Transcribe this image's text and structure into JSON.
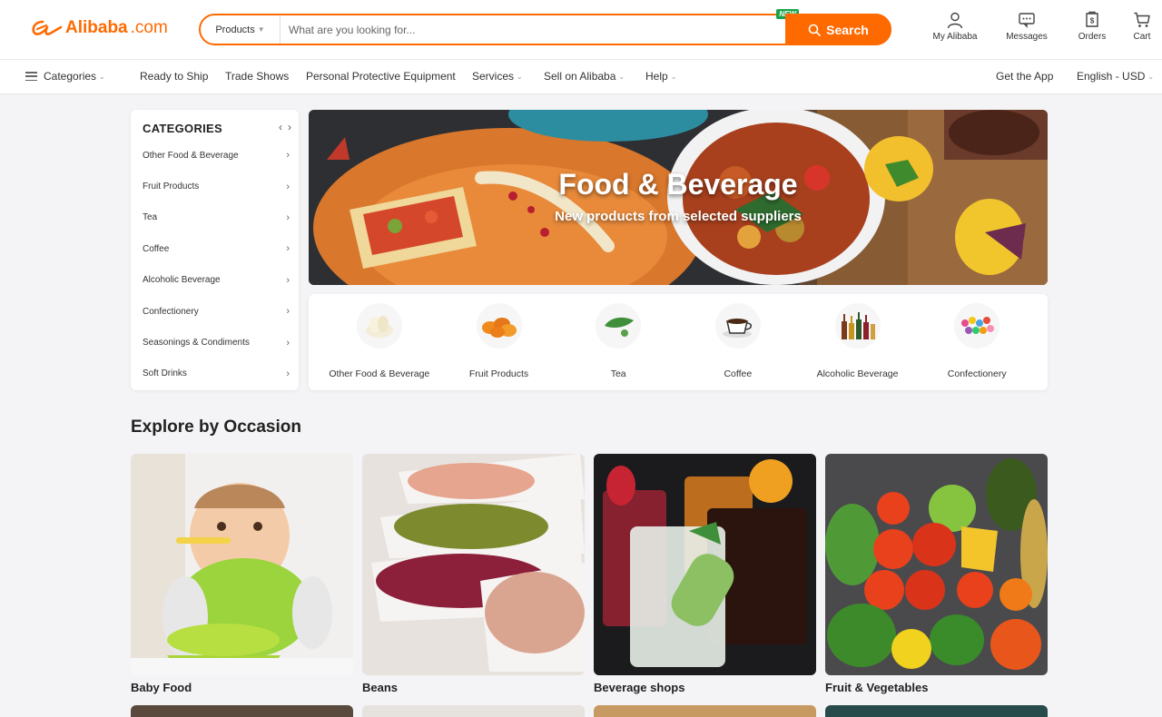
{
  "header": {
    "logo_text": "Alibaba",
    "logo_suffix": ".com",
    "search_category": "Products",
    "search_placeholder": "What are you looking for...",
    "new_badge": "NEW",
    "search_label": "Search",
    "actions": [
      {
        "label": "My Alibaba",
        "icon": "user-icon"
      },
      {
        "label": "Messages",
        "icon": "message-icon"
      },
      {
        "label": "Orders",
        "icon": "orders-icon"
      },
      {
        "label": "Cart",
        "icon": "cart-icon"
      }
    ]
  },
  "nav": {
    "categories": "Categories",
    "items": [
      "Ready to Ship",
      "Trade Shows",
      "Personal Protective Equipment",
      "Services",
      "Sell on Alibaba",
      "Help"
    ],
    "get_app": "Get the App",
    "language": "English - USD"
  },
  "sidebar": {
    "title": "CATEGORIES",
    "items": [
      "Other Food & Beverage",
      "Fruit Products",
      "Tea",
      "Coffee",
      "Alcoholic Beverage",
      "Confectionery",
      "Seasonings & Condiments",
      "Soft Drinks"
    ]
  },
  "hero": {
    "title": "Food & Beverage",
    "subtitle": "New products from selected suppliers"
  },
  "category_strip": [
    {
      "label": "Other Food & Beverage",
      "icon": "garlic-icon"
    },
    {
      "label": "Fruit Products",
      "icon": "dried-apricot-icon"
    },
    {
      "label": "Tea",
      "icon": "tea-leaf-icon"
    },
    {
      "label": "Coffee",
      "icon": "coffee-cup-icon"
    },
    {
      "label": "Alcoholic Beverage",
      "icon": "bottles-icon"
    },
    {
      "label": "Confectionery",
      "icon": "candy-icon"
    }
  ],
  "explore": {
    "title": "Explore by Occasion",
    "items": [
      {
        "label": "Baby Food"
      },
      {
        "label": "Beans"
      },
      {
        "label": "Beverage shops"
      },
      {
        "label": "Fruit & Vegetables"
      }
    ]
  },
  "colors": {
    "brand": "#ff6a00",
    "new_badge": "#1aa34a"
  }
}
